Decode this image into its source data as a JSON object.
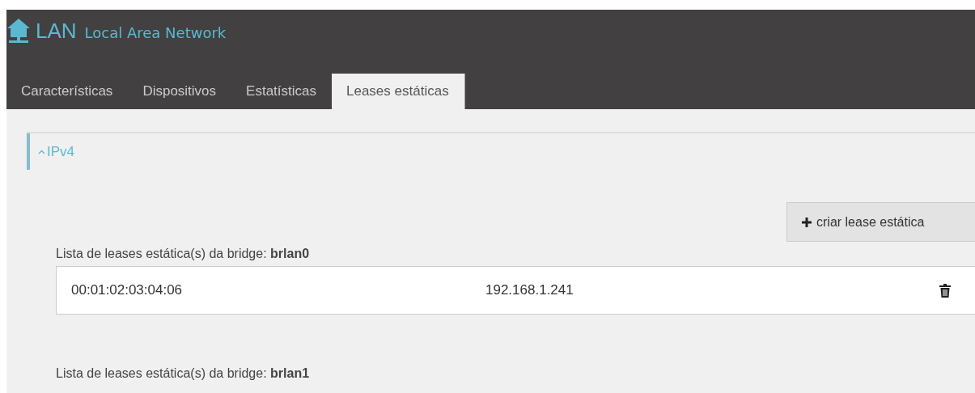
{
  "header": {
    "title": "LAN",
    "subtitle": "Local Area Network"
  },
  "tabs": [
    {
      "label": "Características",
      "selected": false
    },
    {
      "label": "Dispositivos",
      "selected": false
    },
    {
      "label": "Estatísticas",
      "selected": false
    },
    {
      "label": "Leases estáticas",
      "selected": true
    }
  ],
  "section": {
    "title": "IPv4",
    "expanded": true,
    "create_button": "criar lease estática",
    "bridges": [
      {
        "heading": "Lista de leases estática(s) da bridge: **brlan0**",
        "leases": [
          {
            "mac": "00:01:02:03:04:06",
            "ip": "192.168.1.241"
          }
        ]
      },
      {
        "heading": "Lista de leases estática(s) da bridge: **brlan1**"
      }
    ]
  }
}
